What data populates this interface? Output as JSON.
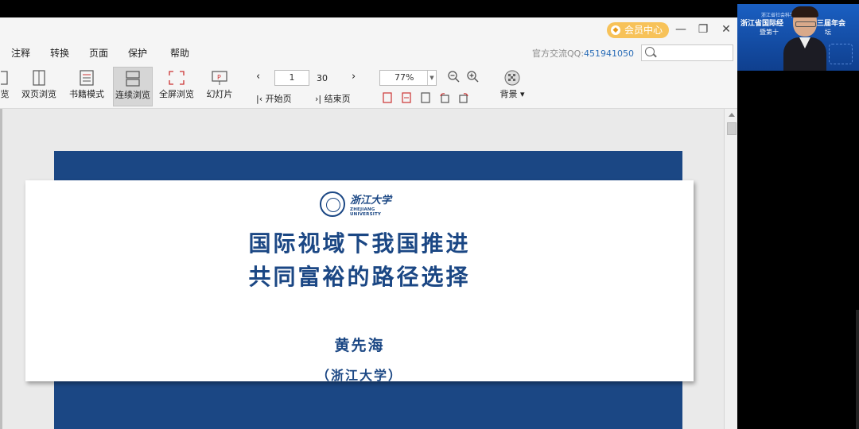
{
  "titlebar": {
    "vip_label": "会员中心",
    "min_glyph": "—",
    "restore_glyph": "❐",
    "close_glyph": "✕"
  },
  "menu": {
    "items": [
      "注释",
      "转换",
      "页面",
      "保护",
      "帮助"
    ],
    "qq_prefix": "官方交流QQ:",
    "qq_number": "451941050",
    "search_placeholder": ""
  },
  "toolbar": {
    "partial_label": "览",
    "buttons": [
      {
        "label": "双页浏览",
        "icon": "dual-page-icon"
      },
      {
        "label": "书籍模式",
        "icon": "book-mode-icon"
      },
      {
        "label": "连续浏览",
        "icon": "continuous-scroll-icon",
        "active": true
      },
      {
        "label": "全屏浏览",
        "icon": "fullscreen-icon"
      },
      {
        "label": "幻灯片",
        "icon": "slideshow-icon"
      }
    ],
    "page_current": "1",
    "page_total": "30",
    "first_page_label": "开始页",
    "last_page_label": "结束页",
    "zoom_value": "77%",
    "background_label": "背景"
  },
  "slide": {
    "logo_zh": "浙江大学",
    "logo_en": "ZHEJIANG UNIVERSITY",
    "title_line1": "国际视域下我国推进",
    "title_line2": "共同富裕的路径选择",
    "author": "黄先海",
    "affiliation": "（浙江大学）"
  },
  "video": {
    "top_text": "浙江省社会科学界",
    "line1": "浙江省国际经",
    "line1_right": "三届年会",
    "line2": "暨第十",
    "line2_right": "坛"
  },
  "colors": {
    "slide_blue": "#1b4784",
    "vip_orange": "#f7c259",
    "qq_blue": "#2a6db7"
  }
}
